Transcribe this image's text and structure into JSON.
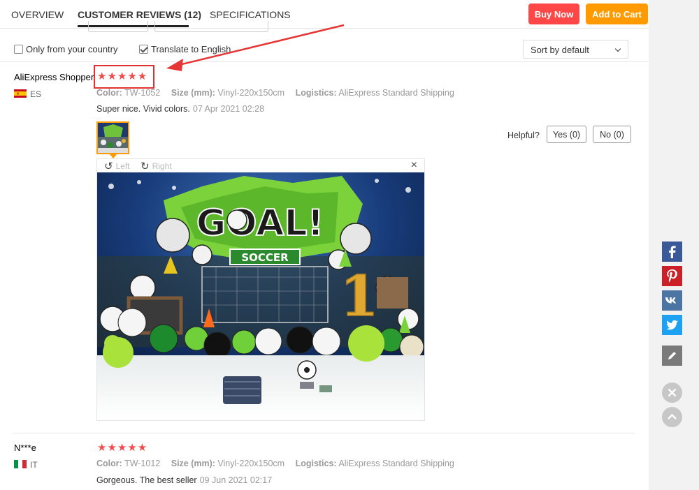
{
  "tabs": [
    {
      "label": "OVERVIEW"
    },
    {
      "label": "CUSTOMER REVIEWS (12)"
    },
    {
      "label": "SPECIFICATIONS"
    }
  ],
  "actions": {
    "buy_now": "Buy Now",
    "add_to_cart": "Add to Cart"
  },
  "filters": {
    "only_country": {
      "label": "Only from your country",
      "checked": false
    },
    "translate": {
      "label": "Translate to English",
      "checked": true
    },
    "sort": {
      "selected": "Sort by default"
    }
  },
  "reviews": [
    {
      "user": "AliExpress Shopper",
      "country": "ES",
      "stars": "★★★★★",
      "rating": 5,
      "color_label": "Color:",
      "color": "TW-1052",
      "size_label": "Size (mm):",
      "size": "Vinyl-220x150cm",
      "logistics_label": "Logistics:",
      "logistics": "AliExpress Standard Shipping",
      "text": "Super nice. Vivid colors.",
      "date": "07 Apr 2021 02:28",
      "helpful": "Helpful?",
      "yes": "Yes (0)",
      "no": "No (0)",
      "viewer": {
        "rotate_left": "Left",
        "rotate_right": "Right",
        "close": "×"
      }
    },
    {
      "user": "N***e",
      "country": "IT",
      "stars": "★★★★★",
      "rating": 5,
      "color_label": "Color:",
      "color": "TW-1012",
      "size_label": "Size (mm):",
      "size": "Vinyl-220x150cm",
      "logistics_label": "Logistics:",
      "logistics": "AliExpress Standard Shipping",
      "text": "Gorgeous. The best seller",
      "date": "09 Jun 2021 02:17"
    }
  ],
  "photo": {
    "banner": "GOAL!",
    "sign": "SOCCER",
    "balloon_number": "1"
  },
  "social": [
    "facebook-icon",
    "pinterest-icon",
    "vk-icon",
    "twitter-icon",
    "edit-icon"
  ],
  "colors": {
    "buy_now": "#ff4747",
    "add_to_cart": "#ff9a00",
    "stars": "#f24b4b",
    "highlight": "#e03030"
  }
}
